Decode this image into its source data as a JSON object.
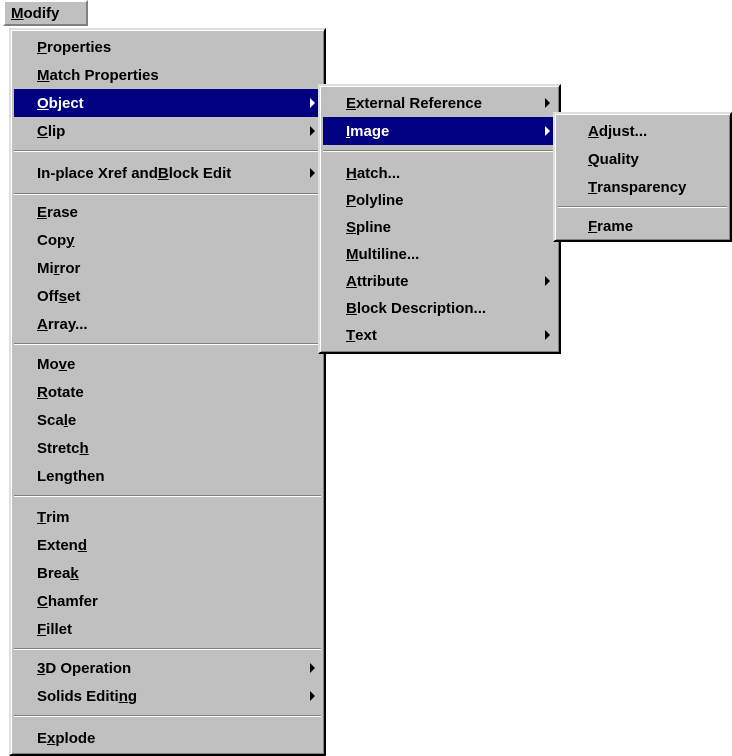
{
  "menubar": {
    "title_prefix": "M",
    "title_rest": "odify"
  },
  "modify_menu": {
    "items": [
      {
        "u": "P",
        "rest": "roperties"
      },
      {
        "u": "M",
        "rest": "atch Properties"
      },
      {
        "u": "O",
        "rest": "bject"
      },
      {
        "u": "C",
        "rest": "lip"
      },
      {
        "pre": "In-place Xref and ",
        "u": "B",
        "rest": "lock Edit"
      },
      {
        "u": "E",
        "rest": "rase"
      },
      {
        "pre": "Cop",
        "u": "y",
        "rest": ""
      },
      {
        "pre": "Mi",
        "u": "r",
        "rest": "ror"
      },
      {
        "pre": "Off",
        "u": "s",
        "rest": "et"
      },
      {
        "u": "A",
        "rest": "rray..."
      },
      {
        "pre": "Mo",
        "u": "v",
        "rest": "e"
      },
      {
        "u": "R",
        "rest": "otate"
      },
      {
        "pre": "Sca",
        "u": "l",
        "rest": "e"
      },
      {
        "pre": "Stretc",
        "u": "h",
        "rest": ""
      },
      {
        "pre": "Len",
        "u": "g",
        "rest": "then"
      },
      {
        "u": "T",
        "rest": "rim"
      },
      {
        "pre": "Exten",
        "u": "d",
        "rest": ""
      },
      {
        "pre": "Brea",
        "u": "k",
        "rest": ""
      },
      {
        "u": "C",
        "rest": "hamfer"
      },
      {
        "u": "F",
        "rest": "illet"
      },
      {
        "u": "3",
        "rest": "D Operation"
      },
      {
        "pre": "Solids Editi",
        "u": "n",
        "rest": "g"
      },
      {
        "pre": "E",
        "u": "x",
        "rest": "plode"
      }
    ]
  },
  "object_menu": {
    "items": [
      {
        "u": "E",
        "rest": "xternal Reference"
      },
      {
        "u": "I",
        "rest": "mage"
      },
      {
        "u": "H",
        "rest": "atch..."
      },
      {
        "u": "P",
        "rest": "olyline"
      },
      {
        "u": "S",
        "rest": "pline"
      },
      {
        "u": "M",
        "rest": "ultiline..."
      },
      {
        "u": "A",
        "rest": "ttribute"
      },
      {
        "u": "B",
        "rest": "lock Description..."
      },
      {
        "u": "T",
        "rest": "ext"
      }
    ]
  },
  "image_menu": {
    "items": [
      {
        "u": "A",
        "rest": "djust..."
      },
      {
        "u": "Q",
        "rest": "uality"
      },
      {
        "u": "T",
        "rest": "ransparency"
      },
      {
        "u": "F",
        "rest": "rame"
      }
    ]
  },
  "colors": {
    "menu_bg": "#c0c0c0",
    "highlight": "#000080",
    "highlight_text": "#ffffff"
  }
}
